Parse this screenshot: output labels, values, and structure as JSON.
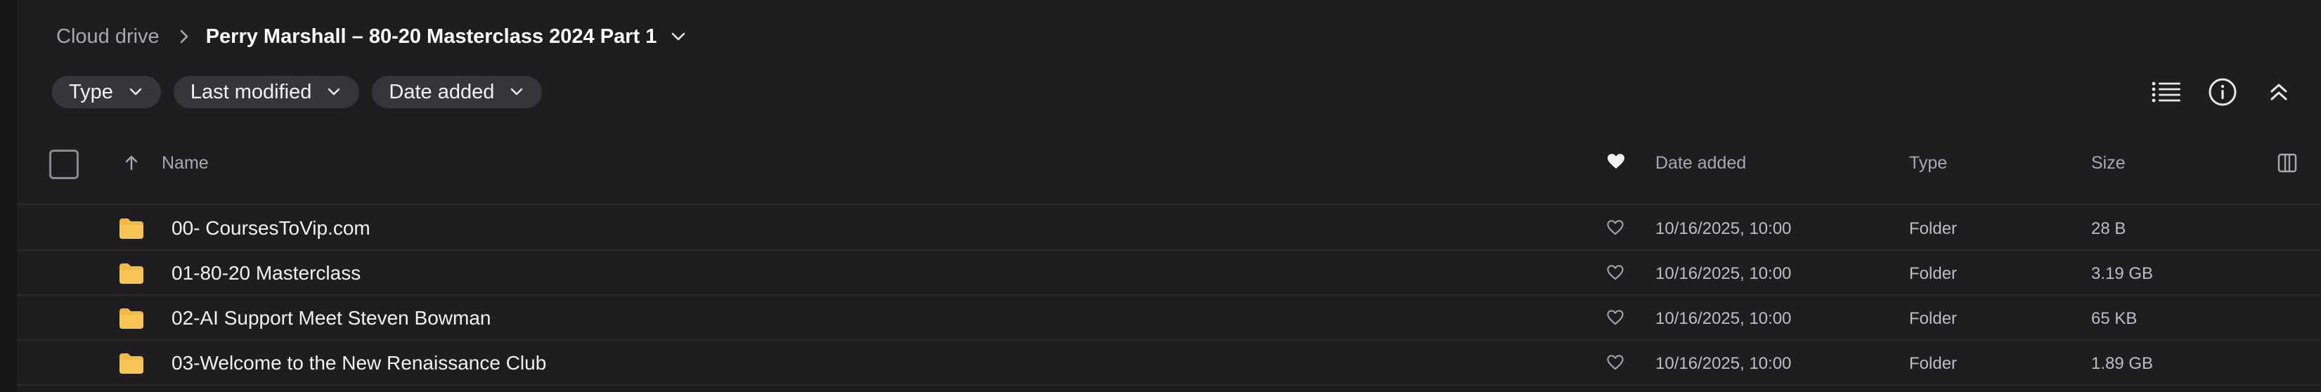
{
  "breadcrumb": {
    "root": "Cloud drive",
    "current": "Perry Marshall – 80-20 Masterclass 2024 Part 1"
  },
  "filters": [
    {
      "label": "Type"
    },
    {
      "label": "Last modified"
    },
    {
      "label": "Date added"
    }
  ],
  "table": {
    "columns": {
      "name": "Name",
      "date_added": "Date added",
      "type": "Type",
      "size": "Size"
    },
    "rows": [
      {
        "name": "00- CoursesToVip.com",
        "date_added": "10/16/2025, 10:00",
        "type": "Folder",
        "size": "28 B"
      },
      {
        "name": "01-80-20 Masterclass",
        "date_added": "10/16/2025, 10:00",
        "type": "Folder",
        "size": "3.19 GB"
      },
      {
        "name": "02-AI Support Meet Steven Bowman",
        "date_added": "10/16/2025, 10:00",
        "type": "Folder",
        "size": "65 KB"
      },
      {
        "name": "03-Welcome to the New Renaissance Club",
        "date_added": "10/16/2025, 10:00",
        "type": "Folder",
        "size": "1.89 GB"
      }
    ]
  },
  "icons": {
    "breadcrumb_separator": "chevron-right-icon",
    "breadcrumb_menu": "chevron-down-icon",
    "list_view": "list-view-icon",
    "info": "info-icon",
    "collapse": "double-chevron-up-icon",
    "sort": "arrow-up-icon",
    "favorite_header": "heart-filled-icon",
    "favorite_row": "heart-outline-icon",
    "columns": "columns-icon",
    "folder": "folder-icon"
  },
  "colors": {
    "background": "#1e1e20",
    "chip": "#35353a",
    "folder": "#f5b940",
    "muted_text": "#a8a8ad"
  }
}
